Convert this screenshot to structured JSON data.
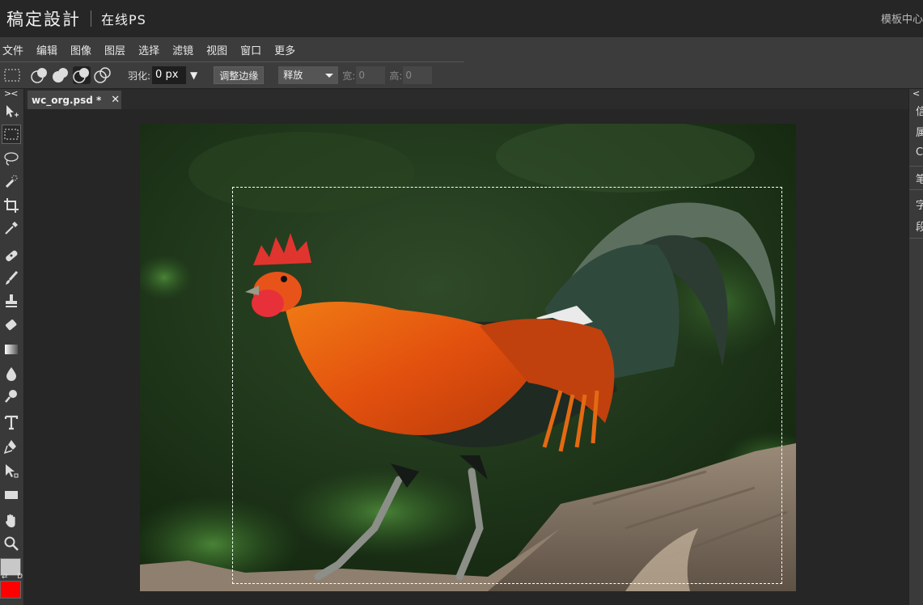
{
  "header": {
    "brand": "稿定設計",
    "product": "在线PS",
    "template_center": "模板中心"
  },
  "menu": [
    "文件",
    "编辑",
    "图像",
    "图层",
    "选择",
    "滤镜",
    "视图",
    "窗口",
    "更多"
  ],
  "options": {
    "feather_label": "羽化:",
    "feather_value": "0  px",
    "refine_edge": "调整边缘",
    "mode": "释放",
    "width_label": "宽:",
    "width_value": "0",
    "height_label": "高:",
    "height_value": "0"
  },
  "toolbar": {
    "collapse": "><",
    "swap": "⇄",
    "default": "D",
    "tools": [
      "move-icon",
      "marquee-icon",
      "lasso-icon",
      "quick-select-icon",
      "crop-icon",
      "eyedropper-icon",
      "healing-icon",
      "brush-icon",
      "stamp-icon",
      "eraser-icon",
      "gradient-icon",
      "blur-icon",
      "dodge-icon",
      "text-icon",
      "pen-icon",
      "path-select-icon",
      "rectangle-icon",
      "hand-icon",
      "zoom-icon"
    ],
    "foreground_color": "#c8c8c8",
    "background_color": "#ff0000"
  },
  "tabs": [
    {
      "label": "wc_org.psd *",
      "close": "✕"
    }
  ],
  "right_panel": {
    "collapse": "<",
    "items": [
      "信",
      "属",
      "C",
      "笔",
      "字",
      "段"
    ]
  },
  "colors": {
    "app_bg": "#282828",
    "menubar": "#3c3c3c",
    "canvas_bg": "#262626"
  }
}
